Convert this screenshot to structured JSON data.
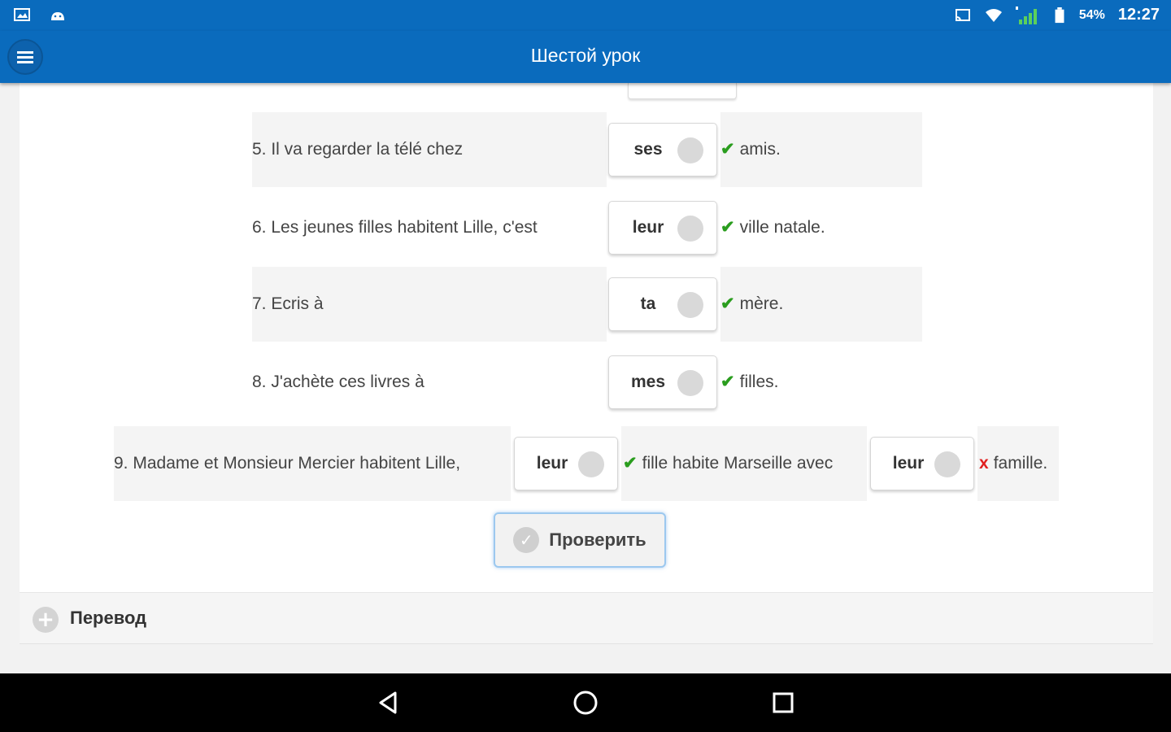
{
  "status_bar": {
    "battery": "54%",
    "time": "12:27"
  },
  "app_bar": {
    "title": "Шестой урок"
  },
  "rows": [
    {
      "sentence": "5. Il va regarder la télé chez",
      "answer": "ses",
      "tail": "amis.",
      "correct": true
    },
    {
      "sentence": "6. Les jeunes filles habitent Lille, c'est",
      "answer": "leur",
      "tail": "ville natale.",
      "correct": true
    },
    {
      "sentence": "7. Ecris à",
      "answer": "ta",
      "tail": "mère.",
      "correct": true
    },
    {
      "sentence": "8. J'achète ces livres à",
      "answer": "mes",
      "tail": "filles.",
      "correct": true
    }
  ],
  "row9": {
    "part1": "9. Madame et Monsieur Mercier habitent Lille,",
    "answer1": "leur",
    "mark1": "✔",
    "part2": "fille habite Marseille avec",
    "answer2": "leur",
    "mark2": "x",
    "part3": "famille."
  },
  "marks": {
    "correct": "✔",
    "wrong": "x"
  },
  "check_button": {
    "label": "Проверить"
  },
  "translation": {
    "label": "Перевод"
  }
}
